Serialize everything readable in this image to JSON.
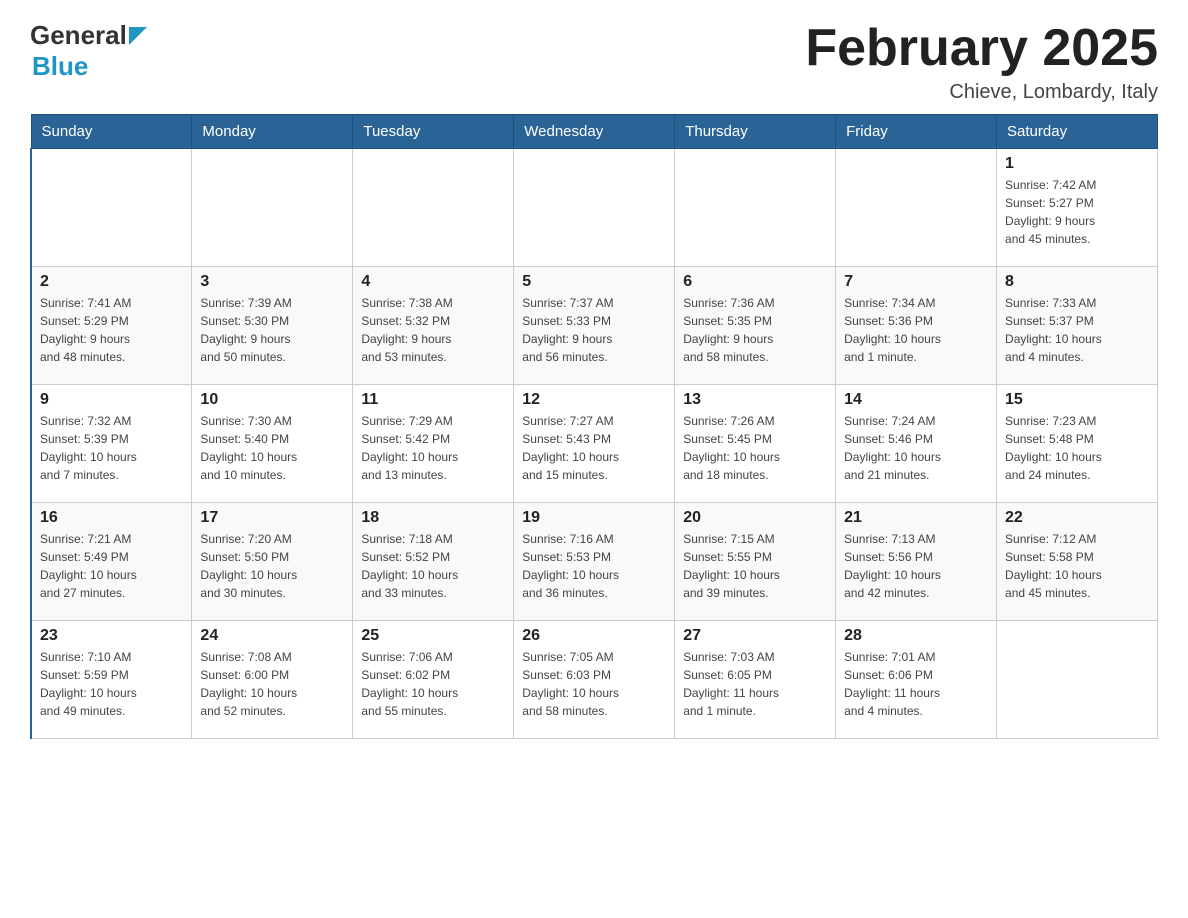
{
  "header": {
    "logo_general": "General",
    "logo_blue": "Blue",
    "month_title": "February 2025",
    "location": "Chieve, Lombardy, Italy"
  },
  "days_of_week": [
    "Sunday",
    "Monday",
    "Tuesday",
    "Wednesday",
    "Thursday",
    "Friday",
    "Saturday"
  ],
  "weeks": [
    [
      {
        "day": "",
        "info": ""
      },
      {
        "day": "",
        "info": ""
      },
      {
        "day": "",
        "info": ""
      },
      {
        "day": "",
        "info": ""
      },
      {
        "day": "",
        "info": ""
      },
      {
        "day": "",
        "info": ""
      },
      {
        "day": "1",
        "info": "Sunrise: 7:42 AM\nSunset: 5:27 PM\nDaylight: 9 hours\nand 45 minutes."
      }
    ],
    [
      {
        "day": "2",
        "info": "Sunrise: 7:41 AM\nSunset: 5:29 PM\nDaylight: 9 hours\nand 48 minutes."
      },
      {
        "day": "3",
        "info": "Sunrise: 7:39 AM\nSunset: 5:30 PM\nDaylight: 9 hours\nand 50 minutes."
      },
      {
        "day": "4",
        "info": "Sunrise: 7:38 AM\nSunset: 5:32 PM\nDaylight: 9 hours\nand 53 minutes."
      },
      {
        "day": "5",
        "info": "Sunrise: 7:37 AM\nSunset: 5:33 PM\nDaylight: 9 hours\nand 56 minutes."
      },
      {
        "day": "6",
        "info": "Sunrise: 7:36 AM\nSunset: 5:35 PM\nDaylight: 9 hours\nand 58 minutes."
      },
      {
        "day": "7",
        "info": "Sunrise: 7:34 AM\nSunset: 5:36 PM\nDaylight: 10 hours\nand 1 minute."
      },
      {
        "day": "8",
        "info": "Sunrise: 7:33 AM\nSunset: 5:37 PM\nDaylight: 10 hours\nand 4 minutes."
      }
    ],
    [
      {
        "day": "9",
        "info": "Sunrise: 7:32 AM\nSunset: 5:39 PM\nDaylight: 10 hours\nand 7 minutes."
      },
      {
        "day": "10",
        "info": "Sunrise: 7:30 AM\nSunset: 5:40 PM\nDaylight: 10 hours\nand 10 minutes."
      },
      {
        "day": "11",
        "info": "Sunrise: 7:29 AM\nSunset: 5:42 PM\nDaylight: 10 hours\nand 13 minutes."
      },
      {
        "day": "12",
        "info": "Sunrise: 7:27 AM\nSunset: 5:43 PM\nDaylight: 10 hours\nand 15 minutes."
      },
      {
        "day": "13",
        "info": "Sunrise: 7:26 AM\nSunset: 5:45 PM\nDaylight: 10 hours\nand 18 minutes."
      },
      {
        "day": "14",
        "info": "Sunrise: 7:24 AM\nSunset: 5:46 PM\nDaylight: 10 hours\nand 21 minutes."
      },
      {
        "day": "15",
        "info": "Sunrise: 7:23 AM\nSunset: 5:48 PM\nDaylight: 10 hours\nand 24 minutes."
      }
    ],
    [
      {
        "day": "16",
        "info": "Sunrise: 7:21 AM\nSunset: 5:49 PM\nDaylight: 10 hours\nand 27 minutes."
      },
      {
        "day": "17",
        "info": "Sunrise: 7:20 AM\nSunset: 5:50 PM\nDaylight: 10 hours\nand 30 minutes."
      },
      {
        "day": "18",
        "info": "Sunrise: 7:18 AM\nSunset: 5:52 PM\nDaylight: 10 hours\nand 33 minutes."
      },
      {
        "day": "19",
        "info": "Sunrise: 7:16 AM\nSunset: 5:53 PM\nDaylight: 10 hours\nand 36 minutes."
      },
      {
        "day": "20",
        "info": "Sunrise: 7:15 AM\nSunset: 5:55 PM\nDaylight: 10 hours\nand 39 minutes."
      },
      {
        "day": "21",
        "info": "Sunrise: 7:13 AM\nSunset: 5:56 PM\nDaylight: 10 hours\nand 42 minutes."
      },
      {
        "day": "22",
        "info": "Sunrise: 7:12 AM\nSunset: 5:58 PM\nDaylight: 10 hours\nand 45 minutes."
      }
    ],
    [
      {
        "day": "23",
        "info": "Sunrise: 7:10 AM\nSunset: 5:59 PM\nDaylight: 10 hours\nand 49 minutes."
      },
      {
        "day": "24",
        "info": "Sunrise: 7:08 AM\nSunset: 6:00 PM\nDaylight: 10 hours\nand 52 minutes."
      },
      {
        "day": "25",
        "info": "Sunrise: 7:06 AM\nSunset: 6:02 PM\nDaylight: 10 hours\nand 55 minutes."
      },
      {
        "day": "26",
        "info": "Sunrise: 7:05 AM\nSunset: 6:03 PM\nDaylight: 10 hours\nand 58 minutes."
      },
      {
        "day": "27",
        "info": "Sunrise: 7:03 AM\nSunset: 6:05 PM\nDaylight: 11 hours\nand 1 minute."
      },
      {
        "day": "28",
        "info": "Sunrise: 7:01 AM\nSunset: 6:06 PM\nDaylight: 11 hours\nand 4 minutes."
      },
      {
        "day": "",
        "info": ""
      }
    ]
  ]
}
